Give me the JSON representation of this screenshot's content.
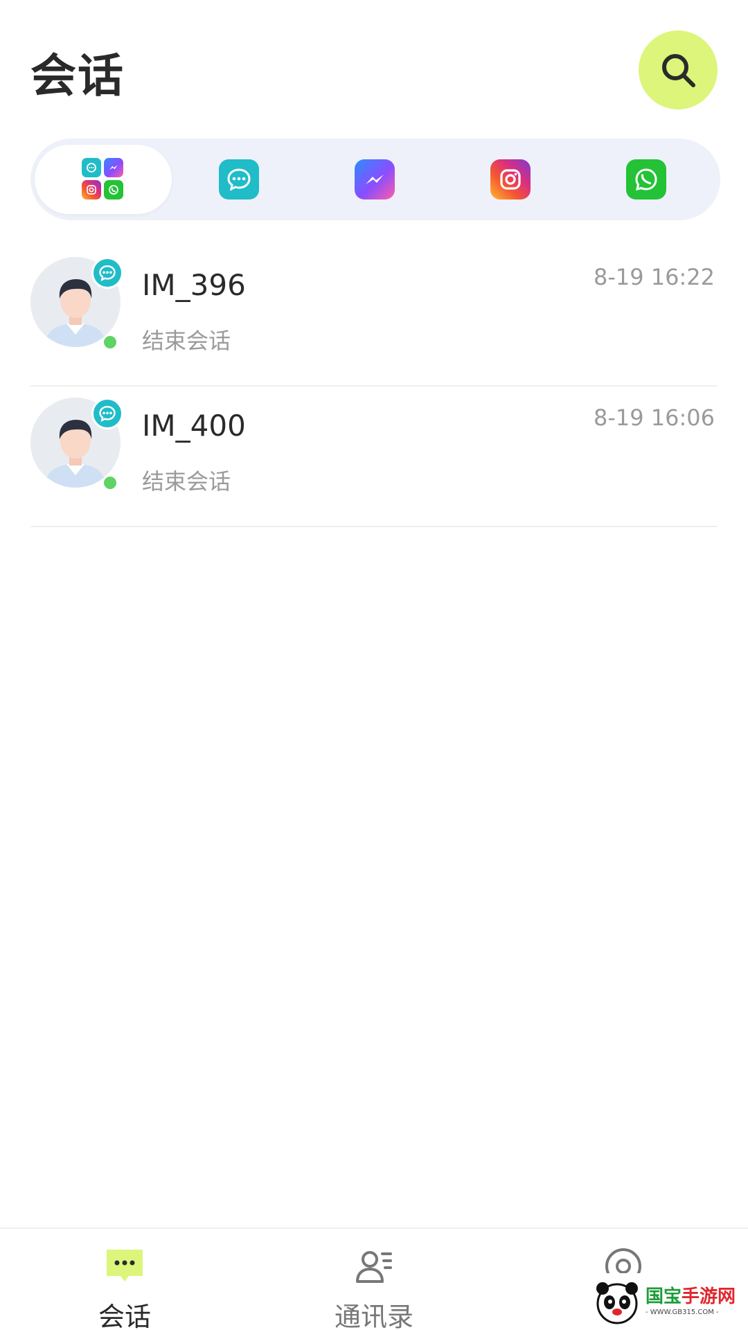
{
  "header": {
    "title": "会话"
  },
  "filters": [
    {
      "name": "all",
      "active": true
    },
    {
      "name": "chat",
      "active": false
    },
    {
      "name": "messenger",
      "active": false
    },
    {
      "name": "instagram",
      "active": false
    },
    {
      "name": "whatsapp",
      "active": false
    }
  ],
  "conversations": [
    {
      "name": "IM_396",
      "time": "8-19 16:22",
      "preview": "结束会话",
      "online": true,
      "channel": "chat"
    },
    {
      "name": "IM_400",
      "time": "8-19 16:06",
      "preview": "结束会话",
      "online": true,
      "channel": "chat"
    }
  ],
  "tabbar": {
    "tabs": [
      {
        "label": "会话",
        "icon": "chat-bubble-icon",
        "active": true
      },
      {
        "label": "通讯录",
        "icon": "contacts-icon",
        "active": false
      },
      {
        "label": "",
        "icon": "profile-icon",
        "active": false
      }
    ]
  },
  "watermark": {
    "text_a": "国宝",
    "text_b": "手游网",
    "url": "- WWW.GB315.COM -"
  },
  "colors": {
    "accent": "#dcf57a",
    "chat_teal": "#20bcc8",
    "online": "#5fd365",
    "whatsapp": "#24c236",
    "filter_bg": "#eef1f9"
  }
}
